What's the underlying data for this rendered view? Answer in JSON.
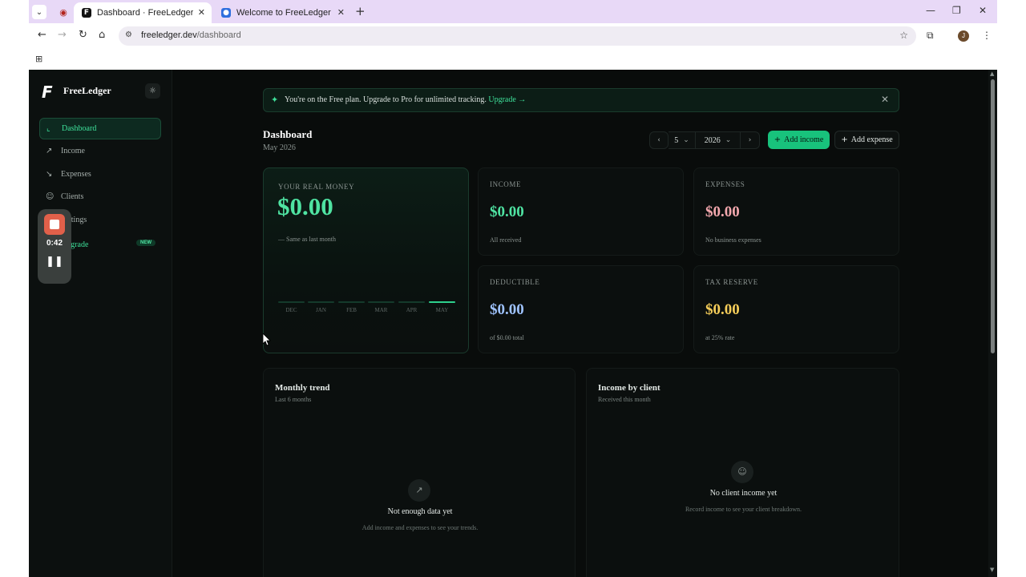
{
  "browser": {
    "tabs": [
      {
        "title": "Dashboard · FreeLedger",
        "favicon": "F",
        "active": true
      },
      {
        "title": "Welcome to FreeLedger · FreeLedger",
        "favicon": "●",
        "active": false
      }
    ],
    "url_host": "freeledger.dev",
    "url_path": "/dashboard",
    "profile_initial": "J"
  },
  "sidebar": {
    "logo": "F",
    "brand": "FreeLedger",
    "items": [
      {
        "label": "Dashboard",
        "icon": "chart-icon"
      },
      {
        "label": "Income",
        "icon": "trend-up-icon"
      },
      {
        "label": "Expenses",
        "icon": "trend-down-icon"
      },
      {
        "label": "Clients",
        "icon": "users-icon"
      },
      {
        "label": "Settings",
        "icon": "gear-icon"
      },
      {
        "label": "Upgrade",
        "icon": "sparkle-icon",
        "badge": "NEW"
      }
    ]
  },
  "recorder": {
    "time": "0:42"
  },
  "banner": {
    "text": "You're on the Free plan. Upgrade to Pro for unlimited tracking.",
    "link": "Upgrade →"
  },
  "header": {
    "title": "Dashboard",
    "subtitle": "May 2026",
    "month": "5",
    "year": "2026",
    "add_income": "Add income",
    "add_expense": "Add expense"
  },
  "hero": {
    "label": "YOUR REAL MONEY",
    "value": "$0.00",
    "note": "— Same as last month",
    "months": [
      "DEC",
      "JAN",
      "FEB",
      "MAR",
      "APR",
      "MAY"
    ]
  },
  "stats": [
    {
      "label": "INCOME",
      "value": "$0.00",
      "note": "All received",
      "color": "#4fe3a2"
    },
    {
      "label": "EXPENSES",
      "value": "$0.00",
      "note": "No business expenses",
      "color": "#f2a7ad"
    },
    {
      "label": "DEDUCTIBLE",
      "value": "$0.00",
      "note": "of $0.00 total",
      "color": "#9fc3ff"
    },
    {
      "label": "TAX RESERVE",
      "value": "$0.00",
      "note": "at 25% rate",
      "color": "#f5cd59"
    }
  ],
  "trend_panel": {
    "title": "Monthly trend",
    "subtitle": "Last 6 months",
    "empty_title": "Not enough data yet",
    "empty_sub": "Add income and expenses to see your trends."
  },
  "client_panel": {
    "title": "Income by client",
    "subtitle": "Received this month",
    "empty_title": "No client income yet",
    "empty_sub": "Record income to see your client breakdown."
  },
  "colors": {
    "accent": "#18c27c",
    "background": "#090c0b"
  }
}
